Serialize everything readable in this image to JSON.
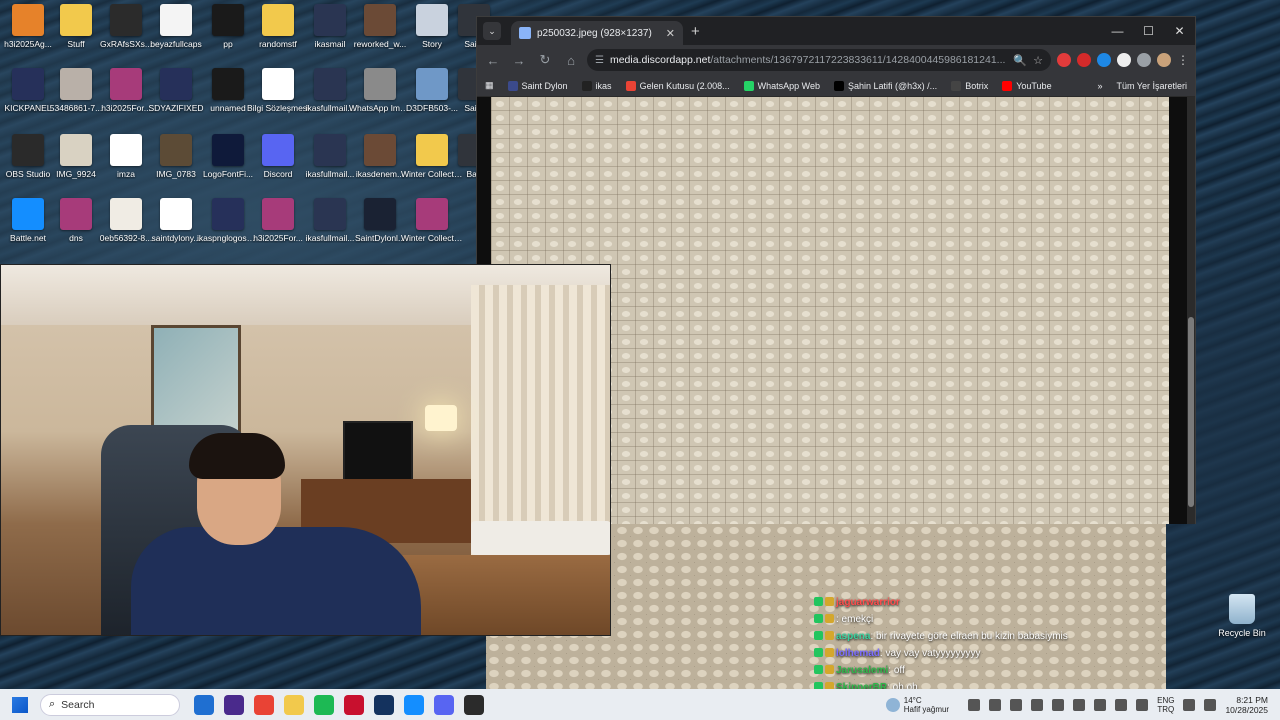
{
  "desktop": {
    "icons": [
      {
        "label": "h3i2025Ag...",
        "color": "#e6822a"
      },
      {
        "label": "Stuff",
        "color": "#f2c94c"
      },
      {
        "label": "GxRAfsSXs...",
        "color": "#2b2b2b"
      },
      {
        "label": "beyazfullcaps",
        "color": "#f4f4f4"
      },
      {
        "label": "pp",
        "color": "#1a1a1a"
      },
      {
        "label": "randomstf",
        "color": "#f2c94c"
      },
      {
        "label": "ikasmail",
        "color": "#2a3552"
      },
      {
        "label": "reworked_w...",
        "color": "#6b4a36"
      },
      {
        "label": "Story",
        "color": "#c9d2de"
      },
      {
        "label": "Saint",
        "color": "#30343b"
      },
      {
        "label": "KICKPANEL",
        "color": "#26305a"
      },
      {
        "label": "53486861-7...",
        "color": "#b9b0a8"
      },
      {
        "label": "h3i2025For...",
        "color": "#a73b7a"
      },
      {
        "label": "SDYAZIFIXED",
        "color": "#26305a"
      },
      {
        "label": "unnamed",
        "color": "#1a1a1a"
      },
      {
        "label": "Bilgi Sözleşmesi",
        "color": "#ffffff"
      },
      {
        "label": "ikasfullmail...",
        "color": "#2a3552"
      },
      {
        "label": "WhatsApp Image 2025...",
        "color": "#8a8a8a"
      },
      {
        "label": "D3DFB503-...",
        "color": "#6f98c7"
      },
      {
        "label": "Saint",
        "color": "#30343b"
      },
      {
        "label": "OBS Studio",
        "color": "#2a2a2a"
      },
      {
        "label": "IMG_9924",
        "color": "#d9d2c2"
      },
      {
        "label": "imza",
        "color": "#ffffff"
      },
      {
        "label": "IMG_0783",
        "color": "#5c4b36"
      },
      {
        "label": "LogoFontFi...",
        "color": "#0f1a3a"
      },
      {
        "label": "Discord",
        "color": "#5865f2"
      },
      {
        "label": "ikasfullmail...",
        "color": "#2a3552"
      },
      {
        "label": "ikasdenem...",
        "color": "#6b4a36"
      },
      {
        "label": "Winter Collection",
        "color": "#f2c94c"
      },
      {
        "label": "Batt",
        "color": "#30343b"
      },
      {
        "label": "Battle.net",
        "color": "#148eff"
      },
      {
        "label": "dns",
        "color": "#a73b7a"
      },
      {
        "label": "0eb56392-8...",
        "color": "#f0ece4"
      },
      {
        "label": "saintdylony...",
        "color": "#ffffff"
      },
      {
        "label": "ikaspnglogos_goodbyedp...",
        "color": "#26305a"
      },
      {
        "label": "h3i2025For...",
        "color": "#a73b7a"
      },
      {
        "label": "ikasfullmail...",
        "color": "#2a3552"
      },
      {
        "label": "SaintDylonl...",
        "color": "#1a2233"
      },
      {
        "label": "Winter Collection",
        "color": "#a73b7a"
      }
    ]
  },
  "browser": {
    "tab_title": "p250032.jpeg (928×1237)",
    "new_tab": "+",
    "url_host": "media.discordapp.net",
    "url_path": "/attachments/1367972117223833611/1428400445986181241...",
    "bookmarks": [
      {
        "label": "Saint Dylon",
        "color": "#3b4a8c"
      },
      {
        "label": "ikas",
        "color": "#222222"
      },
      {
        "label": "Gelen Kutusu (2.008...",
        "color": "#ea4335"
      },
      {
        "label": "WhatsApp Web",
        "color": "#25d366"
      },
      {
        "label": "Şahin Latifi (@h3x) /...",
        "color": "#000000"
      },
      {
        "label": "Botrix",
        "color": "#444444"
      },
      {
        "label": "YouTube",
        "color": "#ff0000"
      }
    ],
    "all_bookmarks": "Tüm Yer İşaretleri",
    "more_bookmarks": "»"
  },
  "chat": {
    "messages": [
      {
        "user": "jaguarwarrior",
        "text": "",
        "color": "#ff4d4d"
      },
      {
        "user": "",
        "text": ": emekçi",
        "color": "#ff4d4d"
      },
      {
        "user": "aspena",
        "text": ": bir rivayete göre elraen bu kizin babasiymis",
        "color": "#38d39f"
      },
      {
        "user": "lolhemad",
        "text": ": vay vay vatyyyyyyyyy",
        "color": "#7b6dff"
      },
      {
        "user": "Jarusalemi",
        "text": ": off",
        "color": "#2fb84a"
      },
      {
        "user": "SkipperBR",
        "text": ": oh oh",
        "color": "#2fb84a"
      }
    ]
  },
  "recycle_bin": {
    "label": "Recycle Bin"
  },
  "taskbar": {
    "search_placeholder": "Search",
    "weather_temp": "14°C",
    "weather_desc": "Hafif yağmur",
    "lang_top": "ENG",
    "lang_bottom": "TRQ",
    "time": "8:21 PM",
    "date": "10/28/2025",
    "apps": [
      "#1f6fd1",
      "#4a2a8c",
      "#e94335",
      "#f2c94c",
      "#1db954",
      "#c8102e",
      "#14325e",
      "#148eff",
      "#5865f2",
      "#2b2b2b"
    ]
  }
}
